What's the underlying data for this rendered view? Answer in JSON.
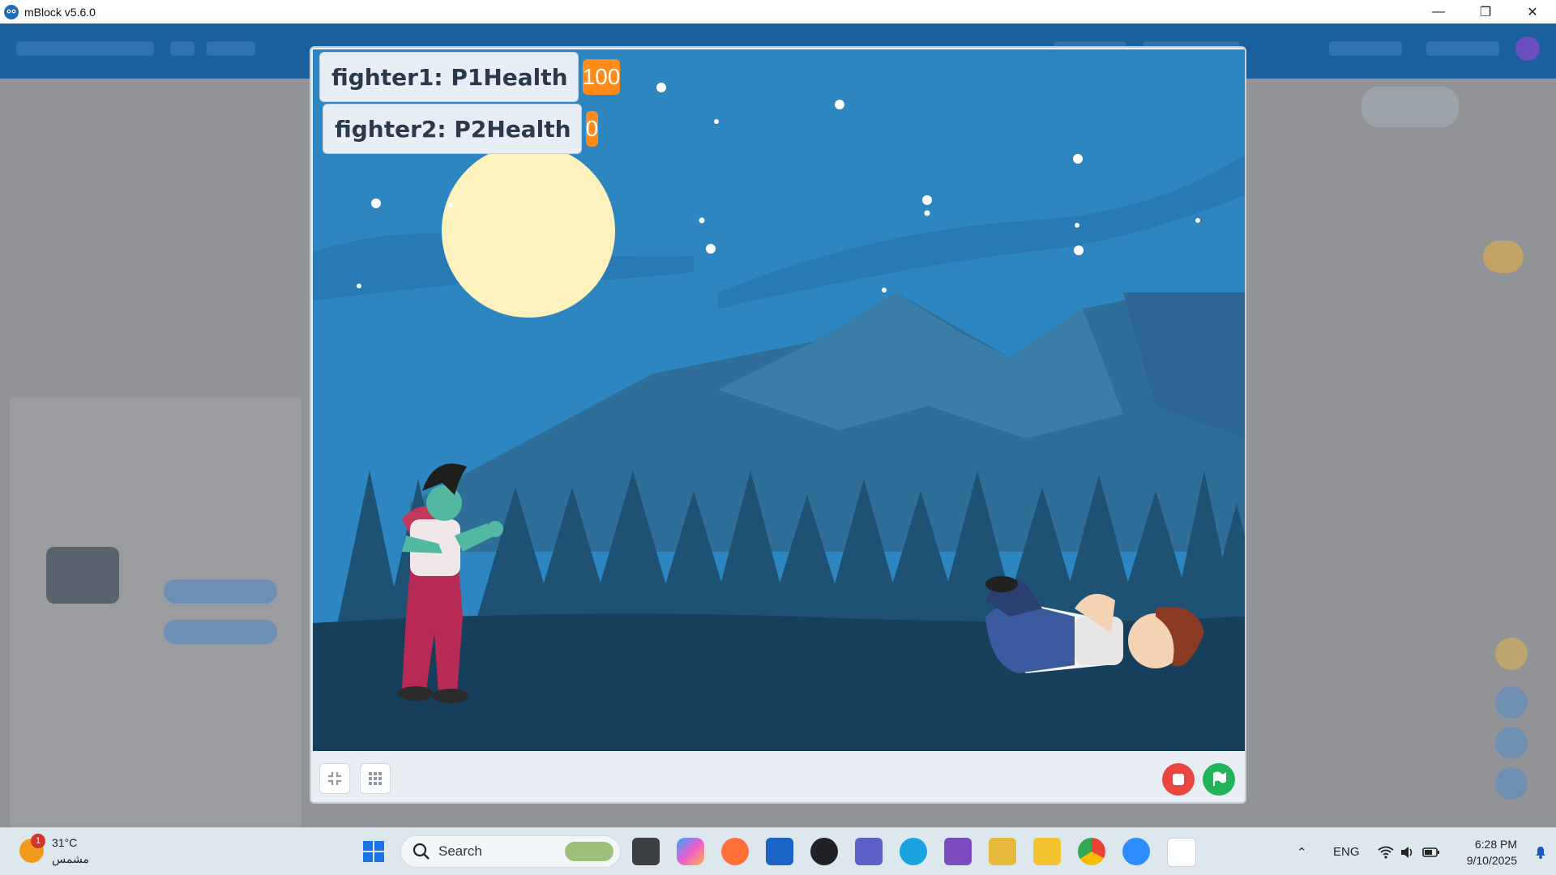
{
  "window": {
    "title": "mBlock v5.6.0",
    "controls": [
      "minimize",
      "restore",
      "close"
    ]
  },
  "stage": {
    "monitors": [
      {
        "label": "fighter1: P1Health",
        "value": "100"
      },
      {
        "label": "fighter2: P2Health",
        "value": "0"
      }
    ],
    "sprites": [
      "fighter1",
      "fighter2"
    ],
    "toolbar": {
      "small_stage_icon": "shrink-stage-icon",
      "grid_icon": "grid-icon",
      "stop_color": "#e8473f",
      "go_color": "#21b35a"
    }
  },
  "taskbar": {
    "weather": {
      "temp": "31°C",
      "condition": "مشمس",
      "badge": "1"
    },
    "search_placeholder": "Search",
    "apps": [
      "start",
      "task-view",
      "copilot",
      "firefox",
      "microsoft-store",
      "obs",
      "teams",
      "edge",
      "visual-studio",
      "snipping-tool",
      "file-explorer",
      "chrome",
      "zoom",
      "mblock"
    ],
    "tray": {
      "language": "ENG"
    },
    "clock": {
      "time": "6:28 PM",
      "date": "9/10/2025"
    }
  },
  "colors": {
    "sky": "#2e86c1",
    "moon": "#fdf1bd",
    "monitor_value": "#ff8c1a"
  }
}
